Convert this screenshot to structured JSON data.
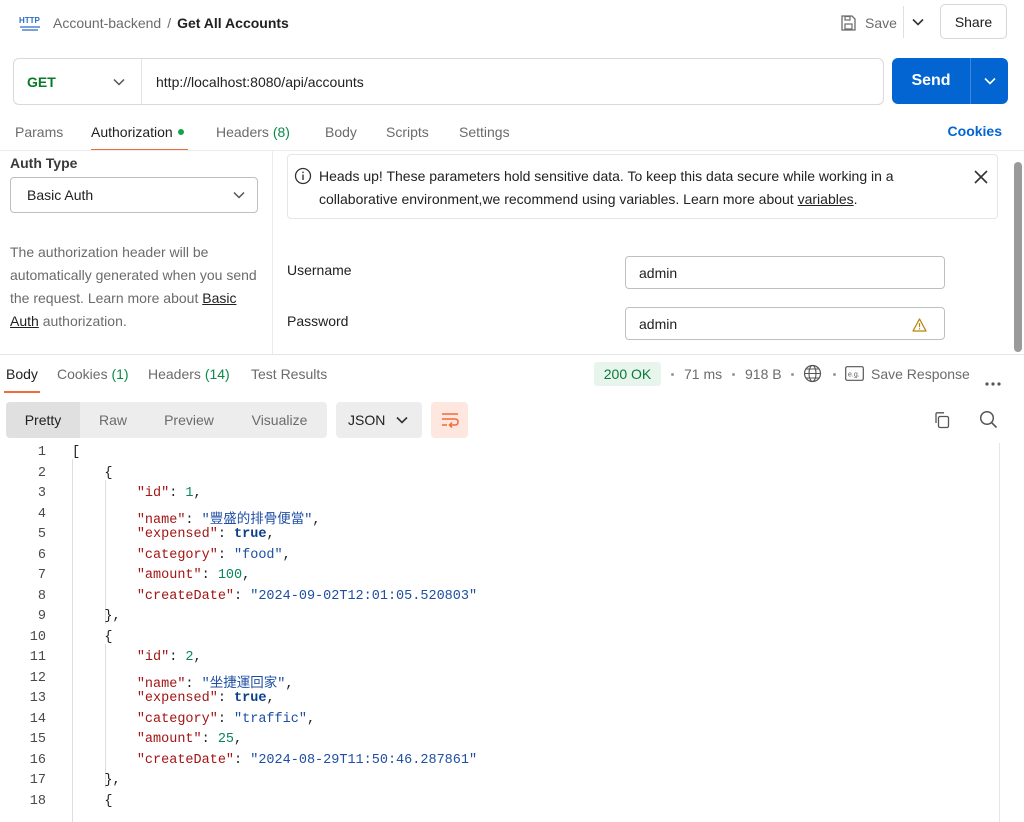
{
  "header": {
    "collection": "Account-backend",
    "separator": "/",
    "request_name": "Get All Accounts",
    "save_label": "Save",
    "share_label": "Share"
  },
  "request": {
    "method": "GET",
    "url": "http://localhost:8080/api/accounts",
    "send_label": "Send"
  },
  "request_tabs": {
    "params": "Params",
    "authorization": "Authorization",
    "headers": "Headers",
    "headers_count": "(8)",
    "body": "Body",
    "scripts": "Scripts",
    "settings": "Settings",
    "cookies": "Cookies"
  },
  "auth": {
    "type_label": "Auth Type",
    "type_value": "Basic Auth",
    "description_prefix": "The authorization header will be automatically generated when you send the request. Learn more about ",
    "description_link": "Basic Auth",
    "description_suffix": " authorization.",
    "notice_text": "Heads up! These parameters hold sensitive data. To keep this data secure while working in a collaborative environment,we recommend using variables. Learn more about ",
    "notice_link": "variables",
    "notice_end": ".",
    "username_label": "Username",
    "username_value": "admin",
    "password_label": "Password",
    "password_value": "admin"
  },
  "response_tabs": {
    "body": "Body",
    "cookies": "Cookies",
    "cookies_count": "(1)",
    "headers": "Headers",
    "headers_count": "(14)",
    "test_results": "Test Results"
  },
  "response_meta": {
    "status": "200 OK",
    "time": "71 ms",
    "size": "918 B",
    "save_response": "Save Response",
    "more": "•••"
  },
  "format": {
    "pretty": "Pretty",
    "raw": "Raw",
    "preview": "Preview",
    "visualize": "Visualize",
    "language": "JSON"
  },
  "code_lines": [
    "1",
    "2",
    "3",
    "4",
    "5",
    "6",
    "7",
    "8",
    "9",
    "10",
    "11",
    "12",
    "13",
    "14",
    "15",
    "16",
    "17",
    "18"
  ],
  "records": [
    {
      "id": "1",
      "name": "\"豐盛的排骨便當\"",
      "expensed": "true",
      "category": "\"food\"",
      "amount": "100",
      "createDate": "\"2024-09-02T12:01:05.520803\""
    },
    {
      "id": "2",
      "name": "\"坐捷運回家\"",
      "expensed": "true",
      "category": "\"traffic\"",
      "amount": "25",
      "createDate": "\"2024-08-29T11:50:46.287861\""
    }
  ],
  "json_keys": {
    "id": "\"id\"",
    "name": "\"name\"",
    "expensed": "\"expensed\"",
    "category": "\"category\"",
    "amount": "\"amount\"",
    "createDate": "\"createDate\""
  },
  "colors": {
    "accent_orange": "#f26b3a",
    "send_blue": "#0265d2",
    "get_green": "#0a7a2a",
    "status_bg": "#e7f5ec"
  }
}
